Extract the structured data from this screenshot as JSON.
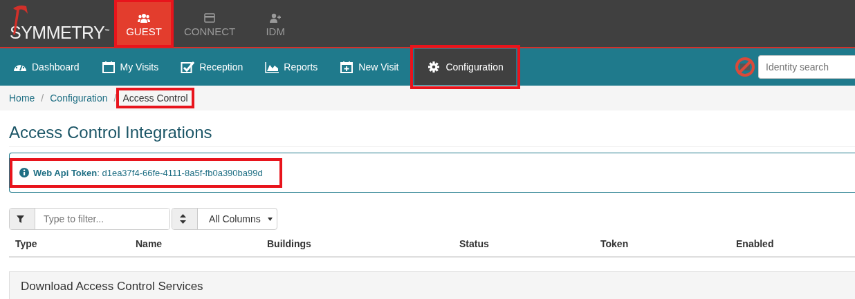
{
  "brand": {
    "name": "SYMMETRY",
    "trademark": "™"
  },
  "apps": [
    {
      "kind": "users",
      "label": "GUEST",
      "selected": true,
      "highlighted": true
    },
    {
      "kind": "card",
      "label": "CONNECT",
      "selected": false,
      "highlighted": false
    },
    {
      "kind": "user-plus",
      "label": "IDM",
      "selected": false,
      "highlighted": false
    }
  ],
  "nav": [
    {
      "kind": "dashboard",
      "label": "Dashboard",
      "selected": false,
      "highlighted": false
    },
    {
      "kind": "calendar",
      "label": "My Visits",
      "selected": false,
      "highlighted": false
    },
    {
      "kind": "check",
      "label": "Reception",
      "selected": false,
      "highlighted": false
    },
    {
      "kind": "chart",
      "label": "Reports",
      "selected": false,
      "highlighted": false
    },
    {
      "kind": "calendar-plus",
      "label": "New Visit",
      "selected": false,
      "highlighted": false
    },
    {
      "kind": "gear",
      "label": "Configuration",
      "selected": true,
      "highlighted": true
    }
  ],
  "search": {
    "placeholder": "Identity search"
  },
  "breadcrumb_separator": "/",
  "breadcrumb": [
    {
      "label": "Home",
      "highlighted": false
    },
    {
      "label": "Configuration",
      "highlighted": false
    },
    {
      "label": "Access Control",
      "highlighted": true
    }
  ],
  "page_title": "Access Control Integrations",
  "info": {
    "label": "Web Api Token",
    "value": ": d1ea37f4-66fe-4111-8a5f-fb0a390ba99d",
    "highlighted": true
  },
  "filter": {
    "placeholder": "Type to filter...",
    "column": "All Columns"
  },
  "table": {
    "columns": [
      "Type",
      "Name",
      "Buildings",
      "Status",
      "Token",
      "Enabled"
    ]
  },
  "panel": {
    "title": "Download Access Control Services"
  }
}
